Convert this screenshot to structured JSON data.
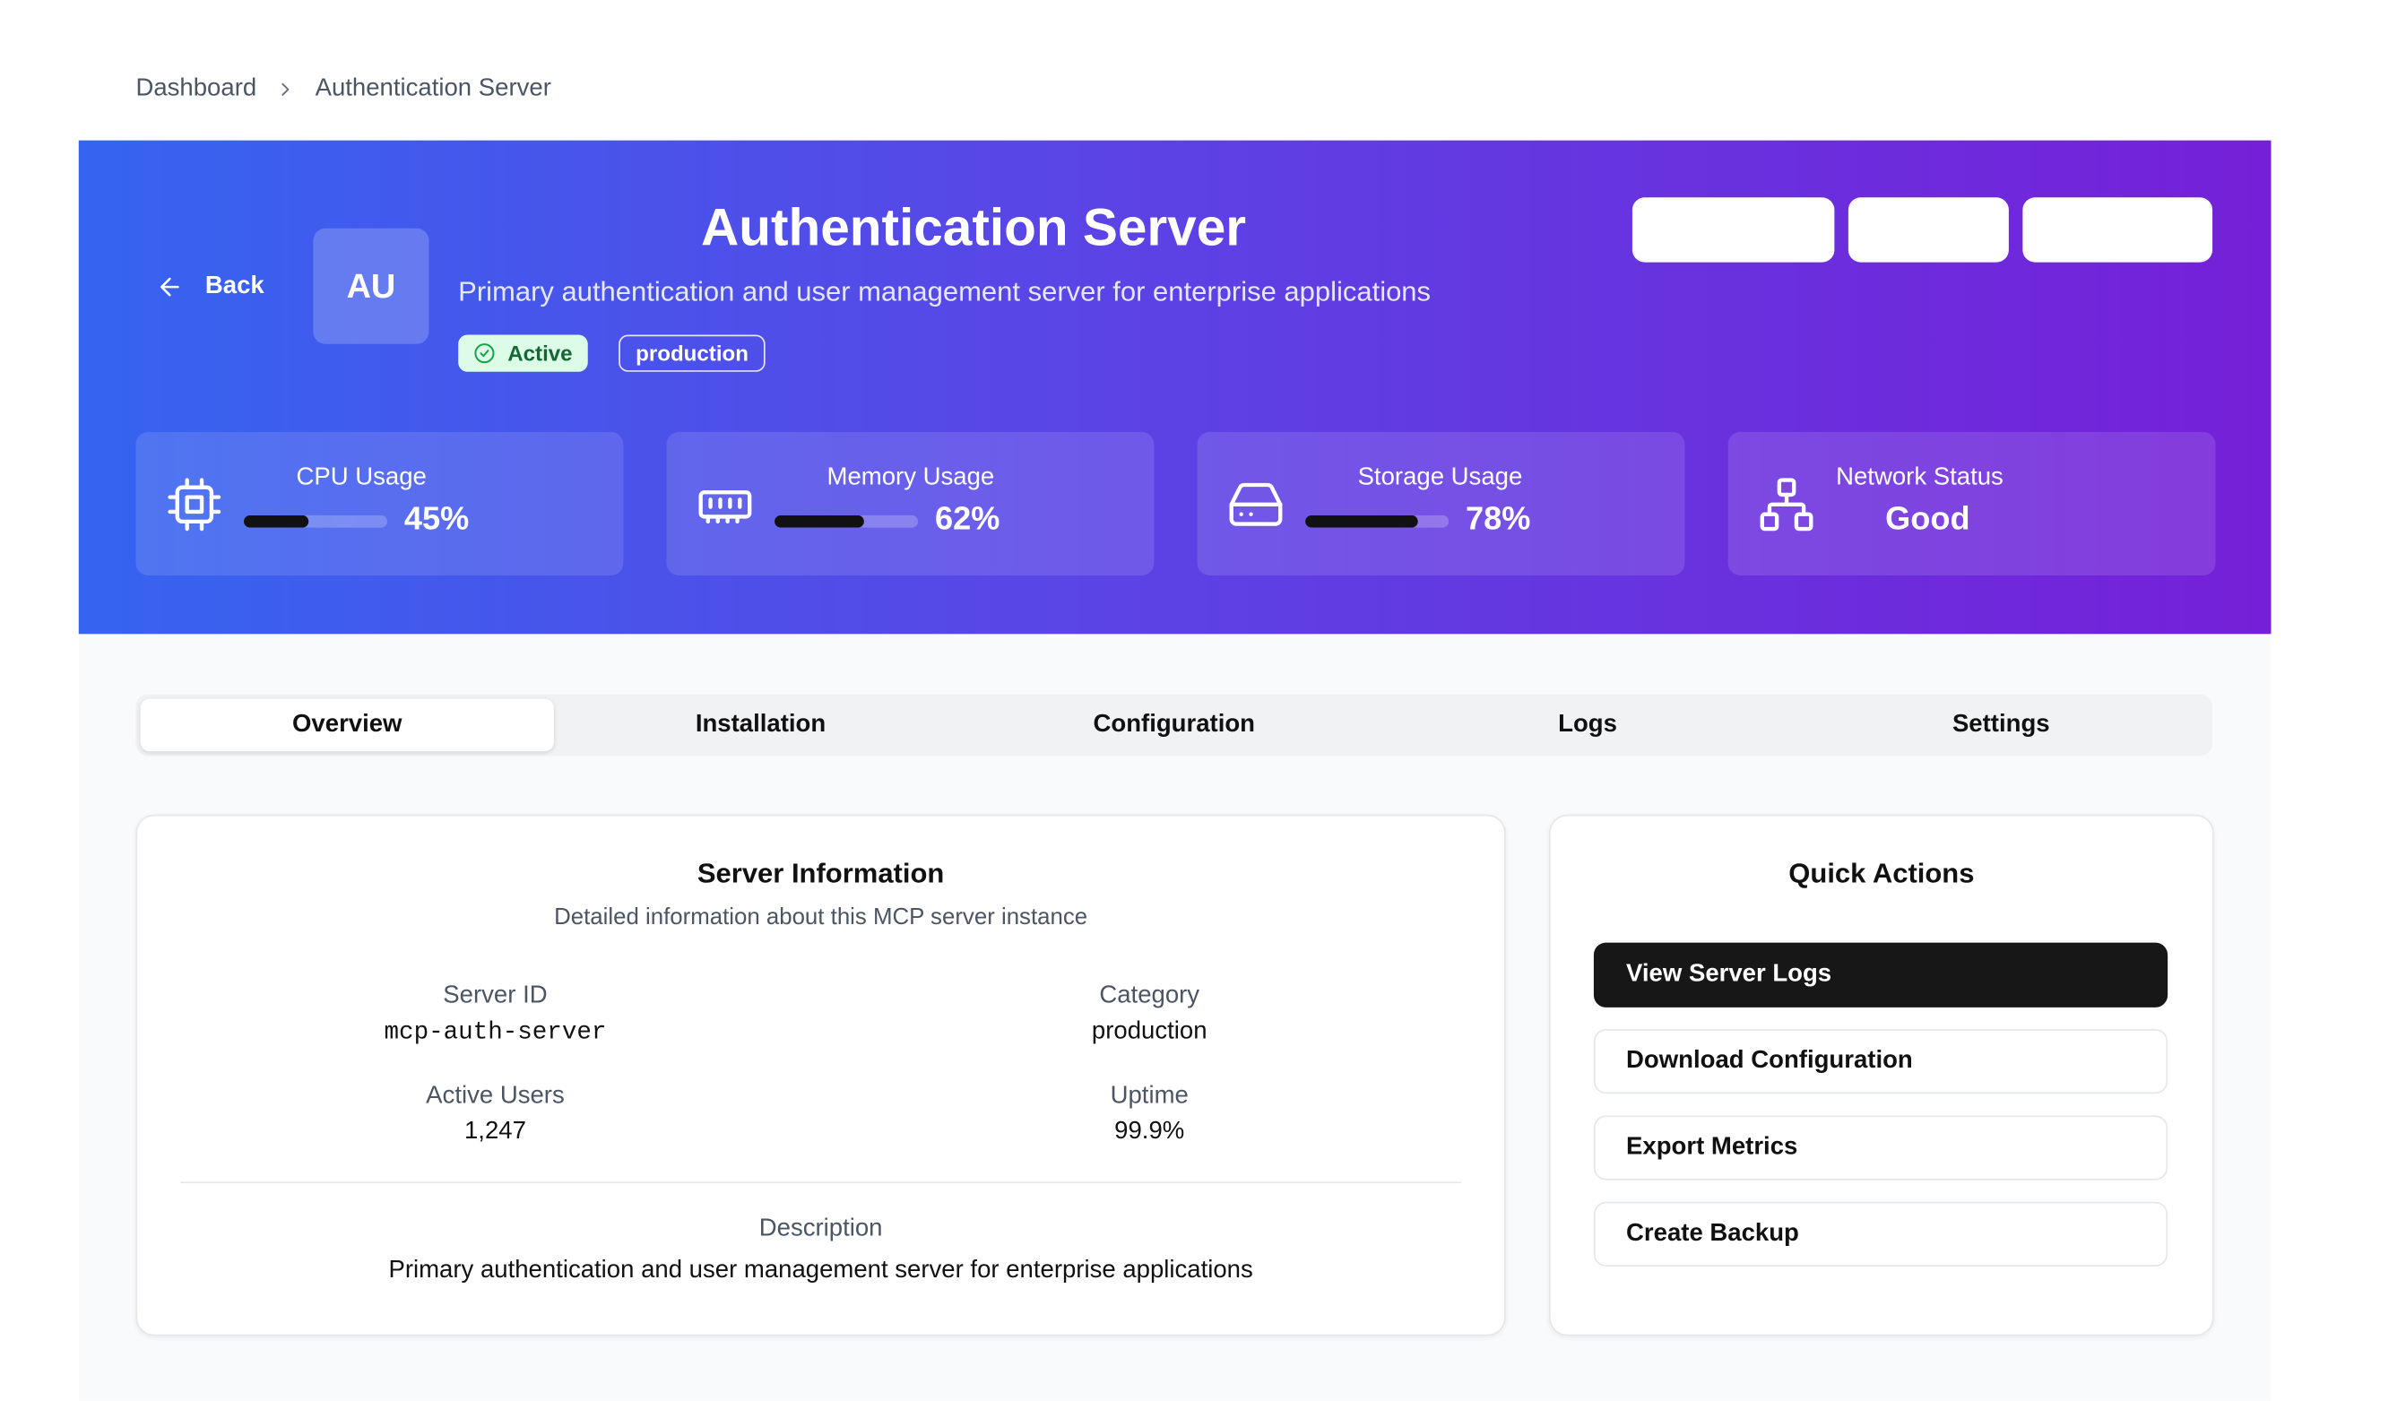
{
  "breadcrumb": {
    "items": [
      "Dashboard",
      "Authentication Server"
    ]
  },
  "header": {
    "back_label": "Back",
    "avatar_initials": "AU",
    "title": "Authentication Server",
    "subtitle": "Primary authentication and user management server for enterprise applications",
    "status_badge": "Active",
    "category_badge": "production",
    "action_buttons": [
      "",
      "",
      ""
    ]
  },
  "metrics": [
    {
      "label": "CPU Usage",
      "value": "45%",
      "percent": 45,
      "icon": "cpu-icon"
    },
    {
      "label": "Memory Usage",
      "value": "62%",
      "percent": 62,
      "icon": "memory-icon"
    },
    {
      "label": "Storage Usage",
      "value": "78%",
      "percent": 78,
      "icon": "hard-drive-icon"
    },
    {
      "label": "Network Status",
      "value": "Good",
      "icon": "network-icon"
    }
  ],
  "tabs": [
    "Overview",
    "Installation",
    "Configuration",
    "Logs",
    "Settings"
  ],
  "active_tab": "Overview",
  "server_info": {
    "title": "Server Information",
    "subtitle": "Detailed information about this MCP server instance",
    "server_id_label": "Server ID",
    "server_id": "mcp-auth-server",
    "category_label": "Category",
    "category": "production",
    "active_users_label": "Active Users",
    "active_users": "1,247",
    "uptime_label": "Uptime",
    "uptime": "99.9%",
    "description_label": "Description",
    "description": "Primary authentication and user management server for enterprise applications"
  },
  "quick_actions": {
    "title": "Quick Actions",
    "items": [
      "View Server Logs",
      "Download Configuration",
      "Export Metrics",
      "Create Backup"
    ]
  },
  "colors": {
    "gradient_start": "#3564f0",
    "gradient_end": "#7520d8",
    "active_badge_bg": "#dcfce7",
    "primary_button": "#171717"
  }
}
